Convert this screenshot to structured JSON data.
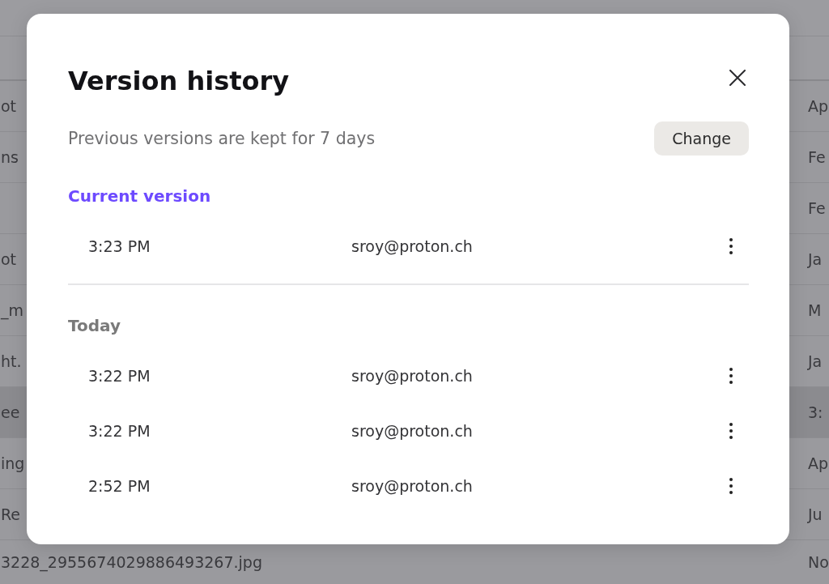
{
  "background_table": {
    "rows": [
      {
        "column_1": "ot",
        "column_2": "Ap",
        "selected": false
      },
      {
        "column_1": "ns",
        "column_2": "Fe",
        "selected": false
      },
      {
        "column_2": "Fe",
        "selected": false
      },
      {
        "column_1": "ot",
        "column_2": "Ja",
        "selected": false
      },
      {
        "column_1": "_m",
        "column_2": "M",
        "selected": false
      },
      {
        "column_1": "ht.",
        "column_2": "Ja",
        "selected": false
      },
      {
        "column_1": "ee",
        "column_2": "3:",
        "selected": true
      },
      {
        "column_1": "ing",
        "column_2": "Ap",
        "selected": false
      },
      {
        "column_1": "Re",
        "column_2": "Ju",
        "selected": false
      },
      {
        "column_1": "3228_2955674029886493267.jpg",
        "column_2": "No",
        "selected": false
      }
    ]
  },
  "dialog": {
    "title": "Version history",
    "retention_note": "Previous versions are kept for 7 days",
    "change_button": "Change",
    "sections": [
      {
        "kind": "current",
        "heading": "Current version",
        "versions": [
          {
            "time": "3:23 PM",
            "author": "sroy@proton.ch"
          }
        ]
      },
      {
        "kind": "date",
        "heading": "Today",
        "versions": [
          {
            "time": "3:22 PM",
            "author": "sroy@proton.ch"
          },
          {
            "time": "3:22 PM",
            "author": "sroy@proton.ch"
          },
          {
            "time": "2:52 PM",
            "author": "sroy@proton.ch"
          }
        ]
      }
    ]
  }
}
